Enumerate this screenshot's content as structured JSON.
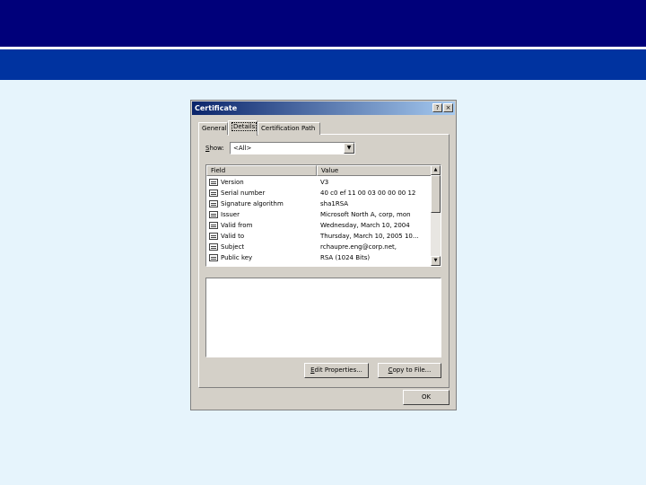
{
  "dialog": {
    "title": "Certificate",
    "help_button": "?",
    "close_button": "×"
  },
  "tabs": [
    {
      "label": "General",
      "active": false
    },
    {
      "label": "Details",
      "active": true
    },
    {
      "label": "Certification Path",
      "active": false
    }
  ],
  "show": {
    "label_accel": "S",
    "label_rest": "how:",
    "value": "<All>"
  },
  "list": {
    "columns": [
      "Field",
      "Value"
    ],
    "rows": [
      {
        "field": "Version",
        "value": "V3"
      },
      {
        "field": "Serial number",
        "value": "40 c0 ef 11 00 03 00 00 00 12"
      },
      {
        "field": "Signature algorithm",
        "value": "sha1RSA"
      },
      {
        "field": "Issuer",
        "value": "Microsoft North A, corp, mon"
      },
      {
        "field": "Valid from",
        "value": "Wednesday, March 10, 2004"
      },
      {
        "field": "Valid to",
        "value": "Thursday, March 10, 2005 10..."
      },
      {
        "field": "Subject",
        "value": "rchaupre.eng@corp.net,"
      },
      {
        "field": "Public key",
        "value": "RSA (1024 Bits)"
      }
    ]
  },
  "buttons": {
    "edit_accel": "E",
    "edit_rest": "dit Properties...",
    "copy_accel": "C",
    "copy_rest": "opy to File...",
    "ok": "OK"
  },
  "colors": {
    "header": "#00007a",
    "band": "#0033a0",
    "background": "#e6f4fc",
    "dialog_face": "#d4d0c8"
  }
}
